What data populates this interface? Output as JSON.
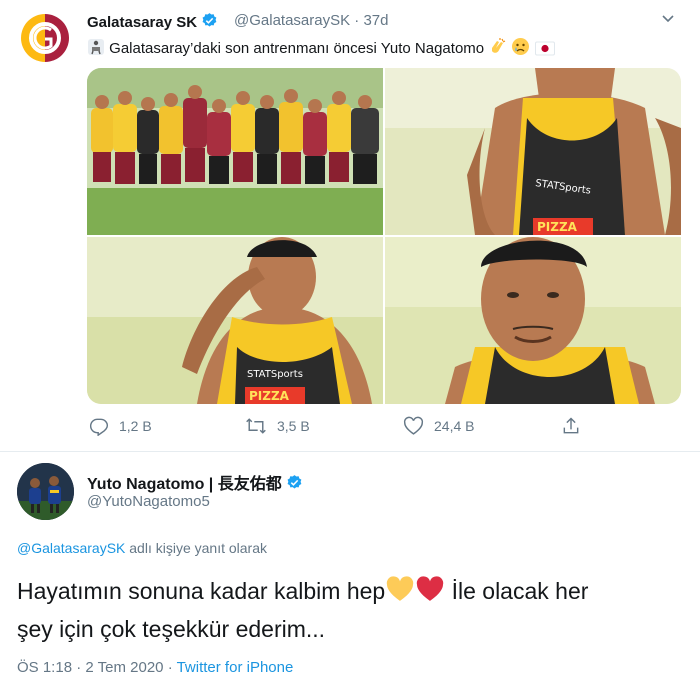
{
  "tweet1": {
    "display_name": "Galatasaray SK",
    "handle": "@GalatasaraySK",
    "separator": "·",
    "time": "37d",
    "text": "Galatasaray’daki son antrenmanı öncesi Yuto Nagatomo",
    "emojis": [
      "clapping-hands",
      "crying-face",
      "flag-japan"
    ],
    "media_count": 4,
    "actions": {
      "replies": "1,2 B",
      "retweets": "3,5 B",
      "likes": "24,4 B"
    }
  },
  "tweet2": {
    "display_name": "Yuto Nagatomo | 長友佑都",
    "handle": "@YutoNagatomo5",
    "reply_mention": "@GalatasaraySK",
    "reply_suffix": "adlı kişiye yanıt olarak",
    "text_line1_a": "Hayatımın sonuna kadar kalbim hep",
    "text_line1_b": "İle olacak her",
    "text_line2": "şey için çok teşekkür ederim...",
    "emojis": [
      "yellow-heart",
      "red-heart"
    ],
    "time": "ÖS 1:18",
    "separator": "·",
    "date": "2 Tem 2020",
    "source_separator": "·",
    "source": "Twitter for iPhone"
  },
  "colors": {
    "accent": "#1b95e0",
    "muted": "#657786",
    "galatasaray_red": "#a9203e",
    "galatasaray_yellow": "#fdb912"
  }
}
